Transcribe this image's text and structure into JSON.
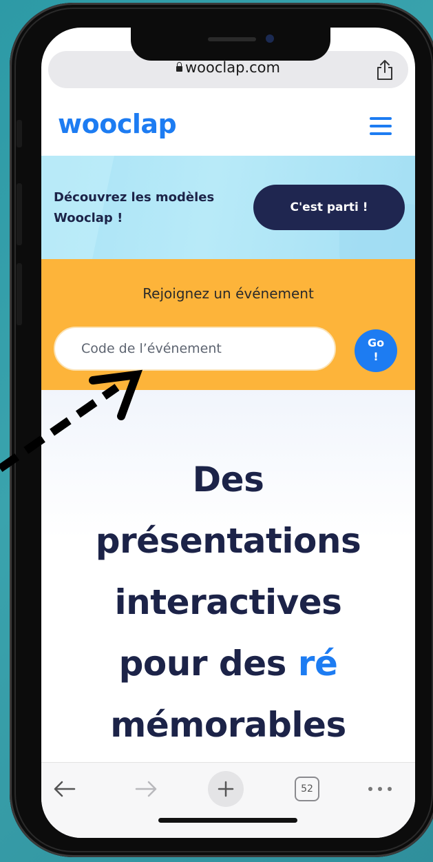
{
  "browser": {
    "url": "wooclap.com",
    "tab_count": "52"
  },
  "header": {
    "logo": "wooclap"
  },
  "banner": {
    "line1": "Découvrez les modèles",
    "line2": "Wooclap !",
    "button_label": "C'est parti !"
  },
  "join": {
    "label": "Rejoignez un événement",
    "input_placeholder": "Code de l’événement",
    "go_line1": "Go",
    "go_line2": "!"
  },
  "hero": {
    "line1": "Des",
    "line2": "présentations",
    "line3": "interactives",
    "line4_part1": "pour des ",
    "line4_accent": "ré",
    "line5": "mémorables"
  },
  "colors": {
    "brand_blue": "#1d7cf2",
    "navy": "#1c2348",
    "banner_blue": "#a9e3f6",
    "join_orange": "#fdb43a",
    "background_teal": "#2d9aa6"
  },
  "icons": [
    "lock-icon",
    "share-icon",
    "hamburger-menu-icon",
    "back-arrow-icon",
    "forward-arrow-icon",
    "plus-icon",
    "tabs-icon",
    "more-icon"
  ]
}
